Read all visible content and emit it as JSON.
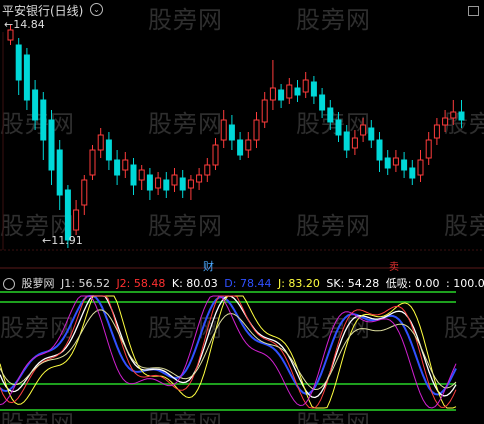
{
  "header": {
    "title": "平安银行(日线)",
    "dropdown_icon": "chevron-down-icon"
  },
  "price": {
    "max_label": "14.84",
    "min_label": "11.91"
  },
  "markers": {
    "cai": "财",
    "sell": "卖"
  },
  "indicator": {
    "name": "股萝网",
    "j1": "J1: 56.52",
    "j2": "J2: 58.48",
    "k": "K: 80.03",
    "d": "D: 78.44",
    "j": "J: 83.20",
    "sk": "SK: 54.28",
    "low": "低吸: 0.00",
    "top": ": 100.00"
  },
  "colors": {
    "up": "#ff3c3c",
    "down": "#00d8d8",
    "green": "#1ea01e",
    "white": "#ffffff",
    "yellow": "#ffff40",
    "blue": "#3050ff",
    "red": "#ff4040",
    "magenta": "#d020d0"
  },
  "watermarks": [
    "股旁网",
    "股旁网",
    "股旁网",
    "股旁网"
  ]
}
